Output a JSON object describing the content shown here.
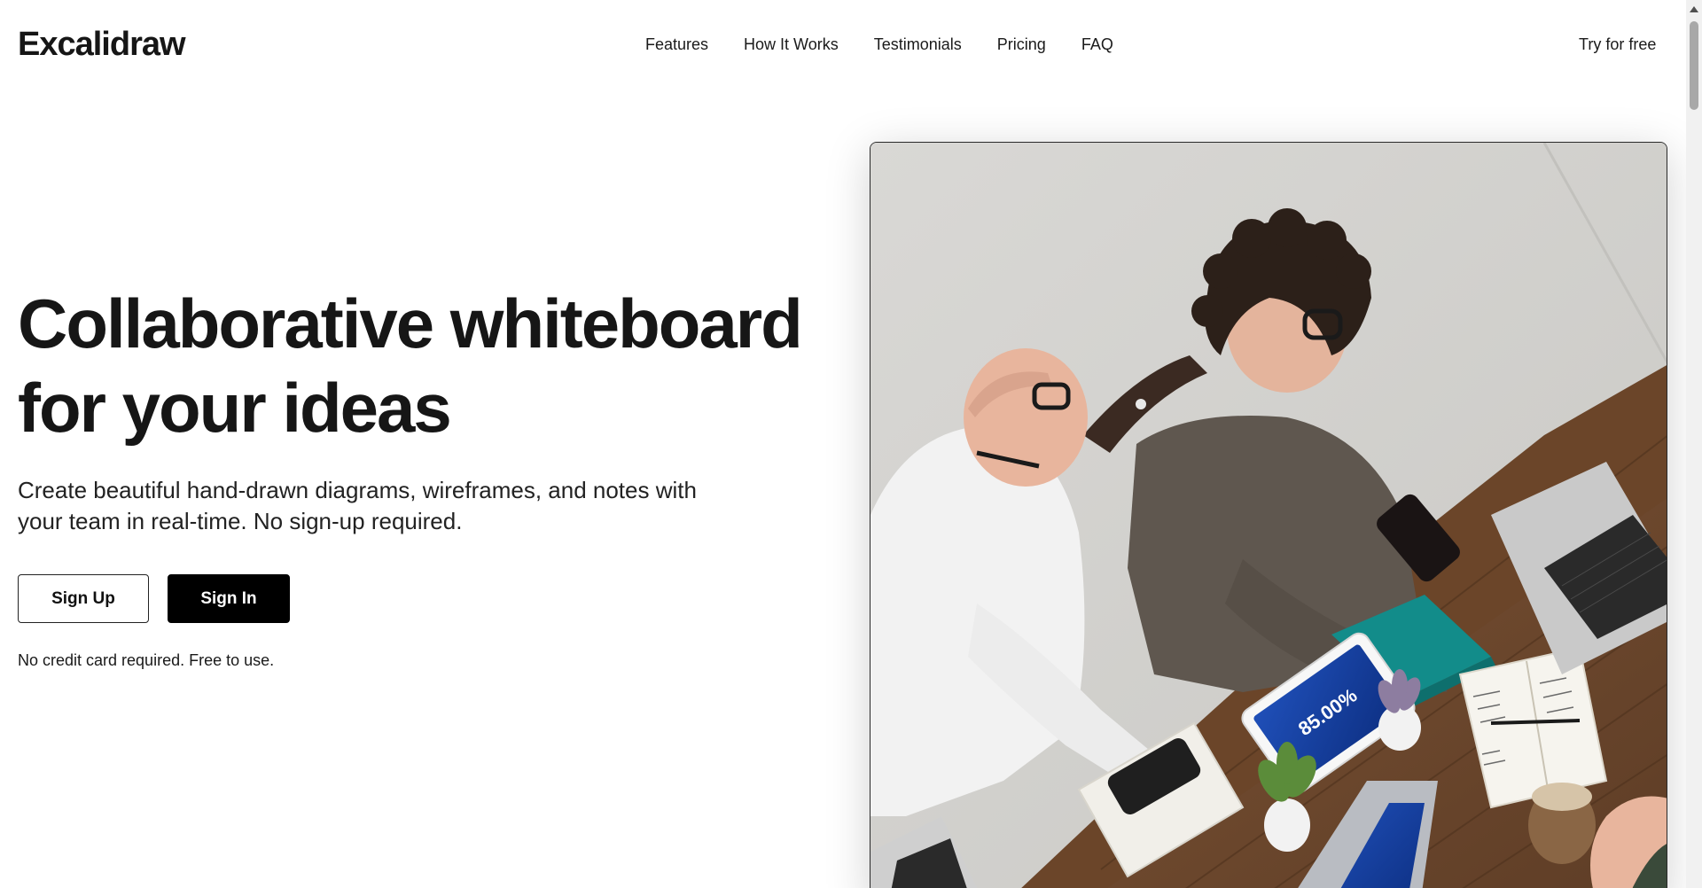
{
  "header": {
    "logo": "Excalidraw",
    "nav": [
      {
        "label": "Features"
      },
      {
        "label": "How It Works"
      },
      {
        "label": "Testimonials"
      },
      {
        "label": "Pricing"
      },
      {
        "label": "FAQ"
      }
    ],
    "cta": "Try for free"
  },
  "hero": {
    "title_line1": "Collaborative whiteboard",
    "title_line2": "for your ideas",
    "subtitle": "Create beautiful hand-drawn diagrams, wireframes, and notes with your team in real-time. No sign-up required.",
    "signup_label": "Sign Up",
    "signin_label": "Sign In",
    "note": "No credit card required. Free to use.",
    "tablet_text": "85.00%"
  },
  "icons": {
    "scroll_up": "chevron-up-icon"
  },
  "colors": {
    "text": "#161616",
    "primary_button": "#000000",
    "background": "#ffffff"
  }
}
